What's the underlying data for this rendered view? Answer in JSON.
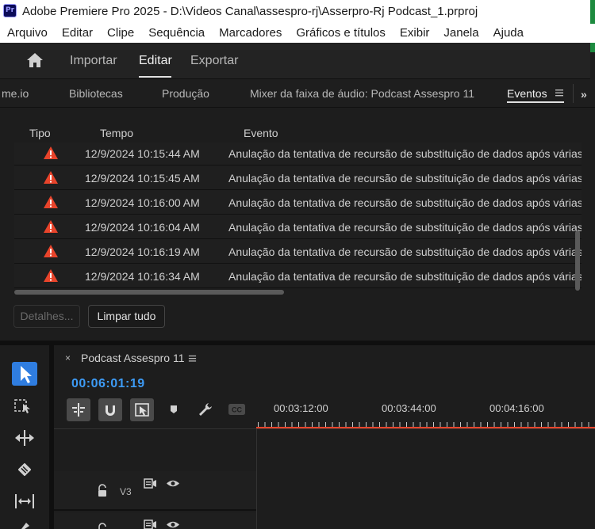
{
  "window": {
    "title": "Adobe Premiere Pro 2025 - D:\\Videos Canal\\assespro-rj\\Asserpro-Rj Podcast_1.prproj",
    "app_badge": "Pr"
  },
  "menu": [
    "Arquivo",
    "Editar",
    "Clipe",
    "Sequência",
    "Marcadores",
    "Gráficos e títulos",
    "Exibir",
    "Janela",
    "Ajuda"
  ],
  "workspace": {
    "tabs": [
      "Importar",
      "Editar",
      "Exportar"
    ],
    "active": "Editar"
  },
  "panel_tabs": {
    "items": [
      "me.io",
      "Bibliotecas",
      "Produção",
      "Mixer da faixa de áudio: Podcast Assespro 11",
      "Eventos"
    ],
    "active": "Eventos"
  },
  "events": {
    "columns": [
      "Tipo",
      "Tempo",
      "Evento"
    ],
    "rows": [
      {
        "type": "warning",
        "time": "12/9/2024 10:15:44 AM",
        "message": "Anulação da tentativa de recursão de substituição de dados após várias t"
      },
      {
        "type": "warning",
        "time": "12/9/2024 10:15:45 AM",
        "message": "Anulação da tentativa de recursão de substituição de dados após várias t"
      },
      {
        "type": "warning",
        "time": "12/9/2024 10:16:00 AM",
        "message": "Anulação da tentativa de recursão de substituição de dados após várias t"
      },
      {
        "type": "warning",
        "time": "12/9/2024 10:16:04 AM",
        "message": "Anulação da tentativa de recursão de substituição de dados após várias t"
      },
      {
        "type": "warning",
        "time": "12/9/2024 10:16:19 AM",
        "message": "Anulação da tentativa de recursão de substituição de dados após várias t"
      },
      {
        "type": "warning",
        "time": "12/9/2024 10:16:34 AM",
        "message": "Anulação da tentativa de recursão de substituição de dados após várias t"
      }
    ],
    "details_label": "Detalhes...",
    "clear_label": "Limpar tudo"
  },
  "timeline": {
    "sequence_name": "Podcast Assespro 11",
    "close_glyph": "×",
    "timecode": "00:06:01:19",
    "ruler_labels": [
      "00:03:12:00",
      "00:03:44:00",
      "00:04:16:00"
    ],
    "track_label": "V3"
  },
  "colors": {
    "accent_blue": "#3d9bf5",
    "warning_red": "#e8442b",
    "select_tool": "#2f7de0"
  },
  "tools": [
    "selection-tool",
    "track-select-forward-tool",
    "ripple-edit-tool",
    "razor-tool",
    "slip-tool",
    "pen-tool"
  ]
}
